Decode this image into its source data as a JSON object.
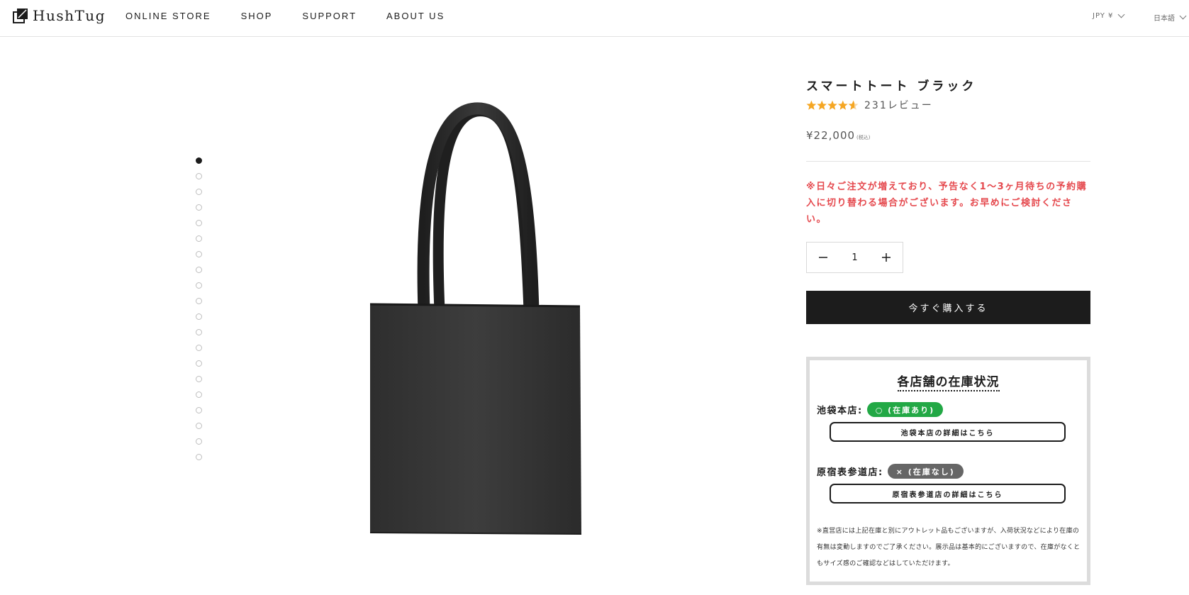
{
  "header": {
    "brand": "HushTug",
    "nav": [
      "ONLINE STORE",
      "SHOP",
      "SUPPORT",
      "ABOUT US"
    ],
    "currency": "JPY ¥",
    "language": "日本語"
  },
  "gallery": {
    "slide_count": 20,
    "active_index": 0
  },
  "product": {
    "title": "スマートトート ブラック",
    "rating": 4.5,
    "review_count": "231レビュー",
    "price": "¥22,000",
    "tax_label": "(税込)",
    "notice": "※日々ご注文が増えており、予告なく1〜3ヶ月待ちの予約購入に切り替わる場合がございます。お早めにご検討ください。",
    "quantity": "1",
    "buy_label": "今すぐ購入する"
  },
  "stock": {
    "title": "各店舗の在庫状況",
    "stores": [
      {
        "name": "池袋本店:",
        "status": "○ (在庫あり)",
        "link": "池袋本店の詳細はこちら"
      },
      {
        "name": "原宿表参道店:",
        "status": "× (在庫なし)",
        "link": "原宿表参道店の詳細はこちら"
      }
    ],
    "note": "※直営店には上記在庫と別にアウトレット品もございますが、入荷状況などにより在庫の有無は変動しますのでご了承ください。展示品は基本的にございますので、在庫がなくともサイズ感のご確認などはしていただけます。"
  },
  "colors": {
    "accent_text": "#e5484d",
    "star": "#f5a623",
    "in_stock": "#22a845",
    "out_of_stock": "#666666",
    "button": "#1c1c1c"
  }
}
